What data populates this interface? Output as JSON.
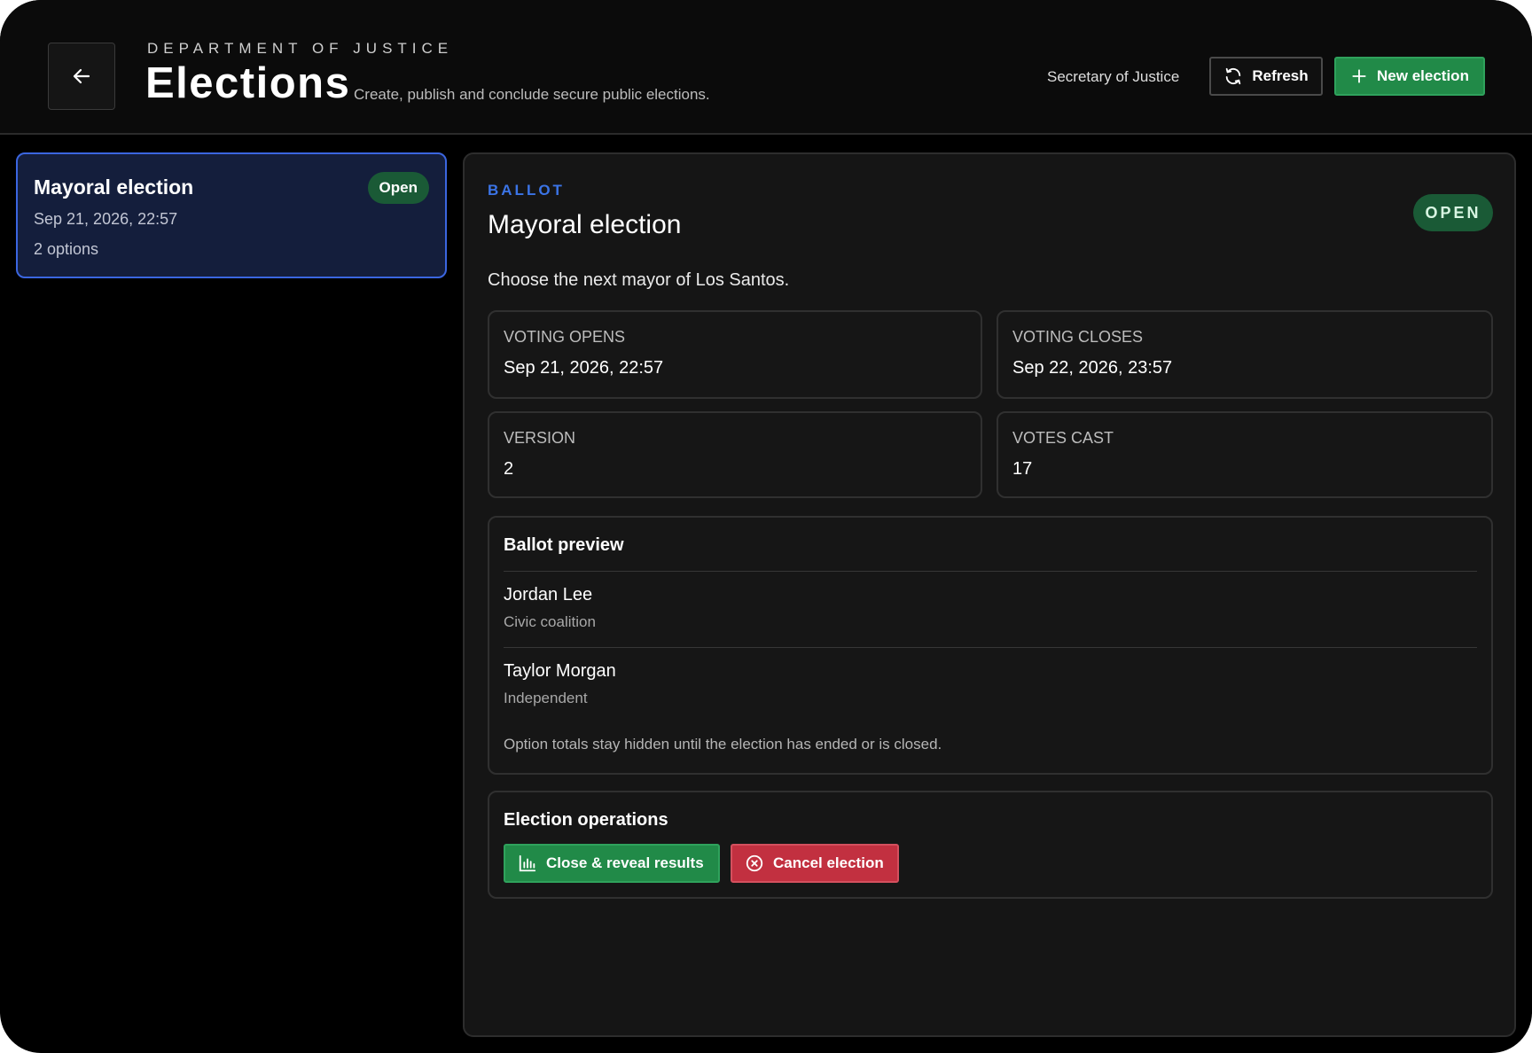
{
  "header": {
    "department": "DEPARTMENT OF JUSTICE",
    "title": "Elections",
    "subtitle": "Create, publish and conclude secure public elections.",
    "role": "Secretary of Justice",
    "refresh_label": "Refresh",
    "new_election_label": "New election",
    "back_icon": "arrow-left-icon"
  },
  "sidebar": {
    "elections": [
      {
        "title": "Mayoral election",
        "date": "Sep 21, 2026, 22:57",
        "options": "2 options",
        "badge": "Open"
      }
    ]
  },
  "detail": {
    "section_label": "BALLOT",
    "title": "Mayoral election",
    "status": "OPEN",
    "description": "Choose the next mayor of Los Santos.",
    "info": [
      {
        "label": "VOTING OPENS",
        "value": "Sep 21, 2026, 22:57"
      },
      {
        "label": "VOTING CLOSES",
        "value": "Sep 22, 2026, 23:57"
      },
      {
        "label": "VERSION",
        "value": "2"
      },
      {
        "label": "VOTES CAST",
        "value": "17"
      }
    ],
    "ballot_preview": {
      "title": "Ballot preview",
      "options": [
        {
          "name": "Jordan Lee",
          "party": "Civic coalition"
        },
        {
          "name": "Taylor Morgan",
          "party": "Independent"
        }
      ],
      "note": "Option totals stay hidden until the election has ended or is closed."
    },
    "operations": {
      "title": "Election operations",
      "close_label": "Close & reveal results",
      "cancel_label": "Cancel election"
    }
  },
  "colors": {
    "accent_blue": "#3b74e6",
    "success_green": "#218a48",
    "danger_red": "#c23040",
    "open_badge": "#1a5a36",
    "selected_card": "#141e3c"
  }
}
